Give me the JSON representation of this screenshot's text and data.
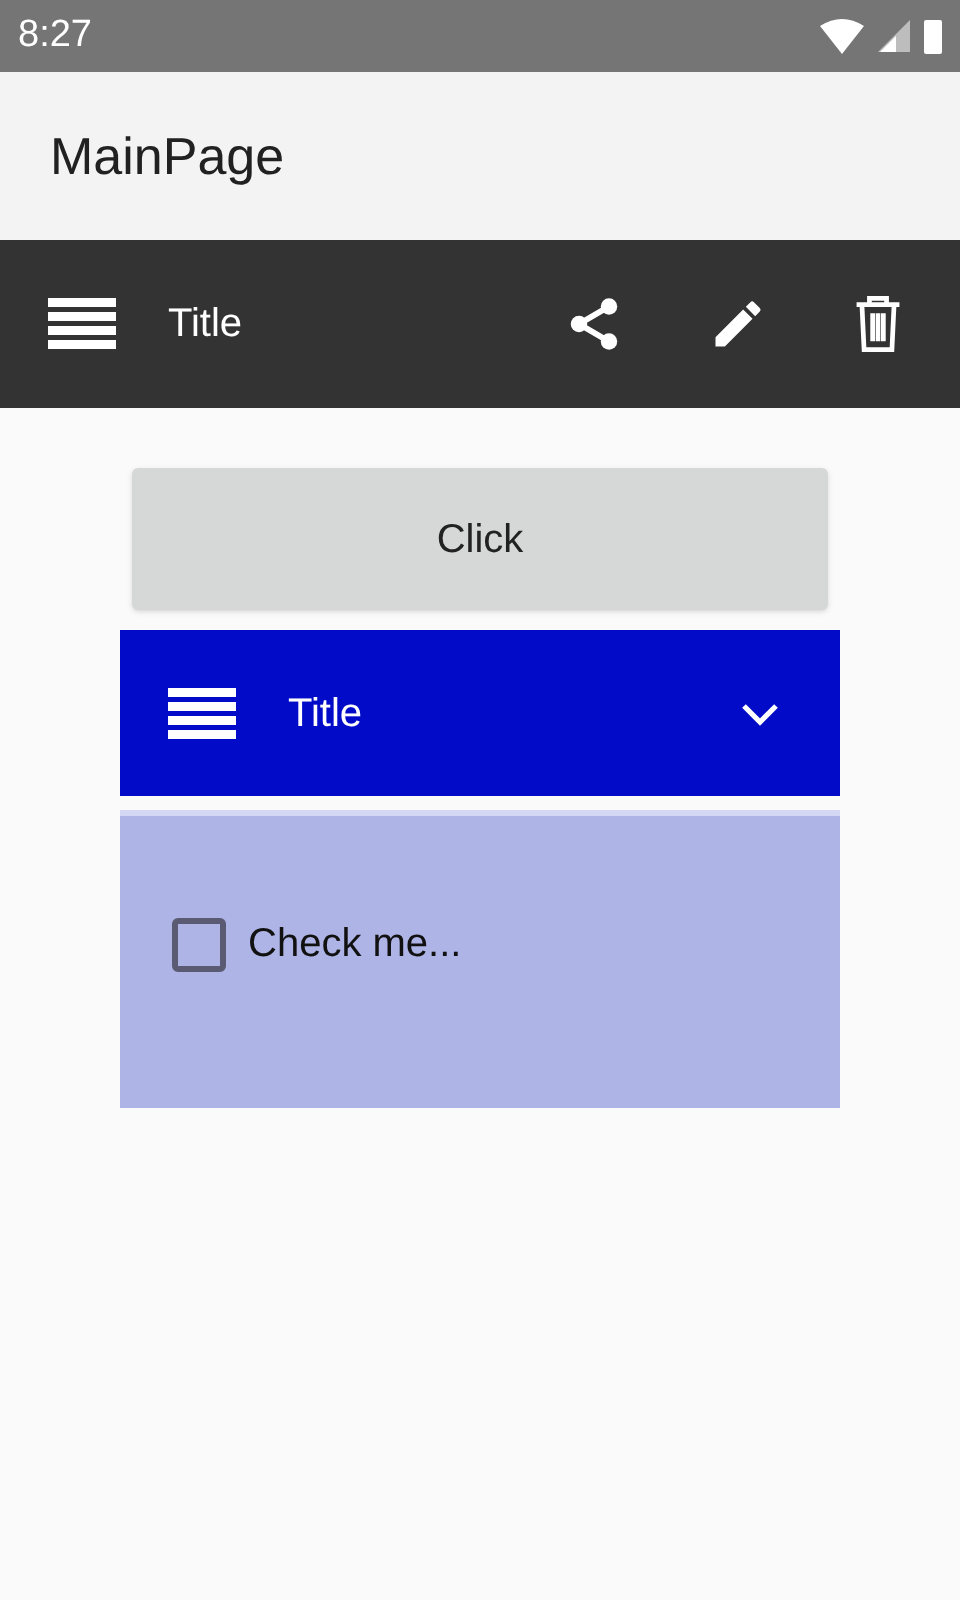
{
  "status_bar": {
    "time": "8:27"
  },
  "page": {
    "title": "MainPage"
  },
  "toolbar": {
    "title": "Title",
    "actions": [
      {
        "kind": "share"
      },
      {
        "kind": "edit"
      },
      {
        "kind": "delete"
      }
    ]
  },
  "button": {
    "label": "Click"
  },
  "expander": {
    "title": "Title",
    "expanded": true,
    "checkbox": {
      "label": "Check me...",
      "checked": false
    }
  }
}
